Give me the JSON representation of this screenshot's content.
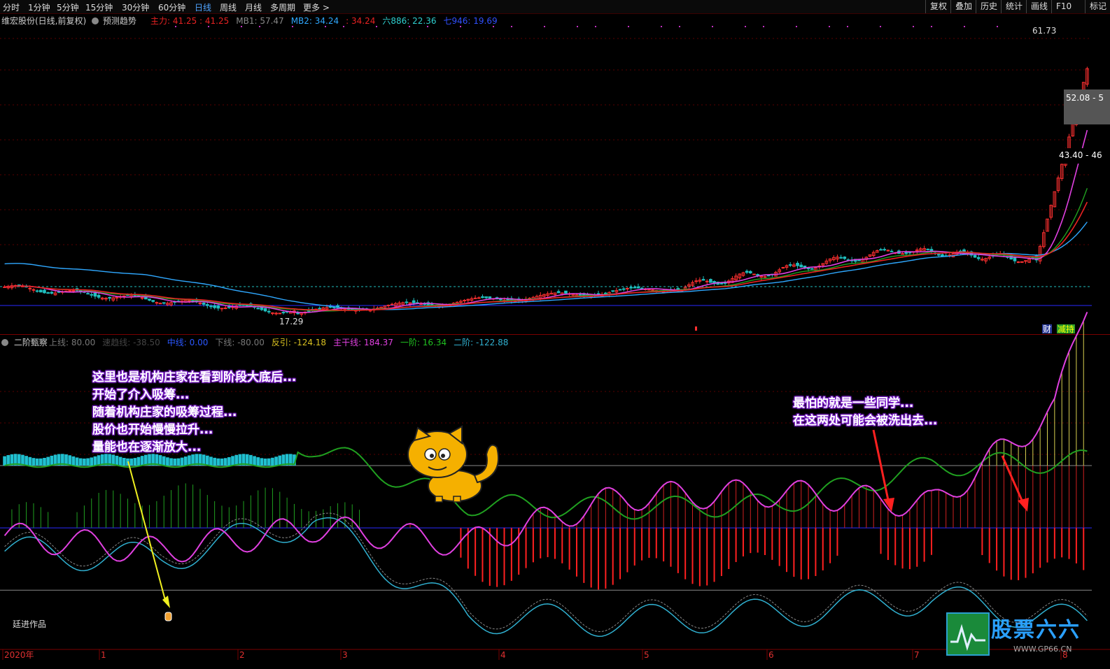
{
  "toolbar": {
    "tabs": [
      "分时",
      "1分钟",
      "5分钟",
      "15分钟",
      "30分钟",
      "60分钟",
      "日线",
      "周线",
      "月线",
      "多周期",
      "更多 >"
    ],
    "active_tab": "日线",
    "right_buttons": [
      "复权",
      "叠加",
      "历史",
      "统计",
      "画线",
      "F10",
      "标记"
    ]
  },
  "main_panel": {
    "stock_title": "维宏股份(日线,前复权)",
    "predict_label": "预测趋势",
    "indicators": [
      {
        "label": "主力: 41.25 : 41.25",
        "color": "#e82222"
      },
      {
        "label": "MB1: 57.47",
        "color": "#888888"
      },
      {
        "label": "MB2: 34.24",
        "color": "#2fa8ff"
      },
      {
        "label": ": 34.24",
        "color": "#e82222"
      },
      {
        "label": "六886: 22.36",
        "color": "#2fd0d0"
      },
      {
        "label": "七946: 19.69",
        "color": "#3050ff"
      }
    ],
    "price_labels": {
      "high": "61.73",
      "low": "17.29",
      "box1": "52.08 - 5",
      "box2": "43.40 - 46"
    },
    "badges": {
      "cai": "财",
      "jian": "减持"
    }
  },
  "sub_panel": {
    "title": "二阶甄察",
    "indicators": [
      {
        "label": "上线: 80.00",
        "color": "#777777"
      },
      {
        "label": "速趋线: -38.50",
        "color": "#444444"
      },
      {
        "label": "中线: 0.00",
        "color": "#2a57ff"
      },
      {
        "label": "下线: -80.00",
        "color": "#777777"
      },
      {
        "label": "反引: -124.18",
        "color": "#d8c020"
      },
      {
        "label": "主干线: 184.37",
        "color": "#e040e0"
      },
      {
        "label": "一阶: 16.34",
        "color": "#20c020"
      },
      {
        "label": "二阶: -122.88",
        "color": "#30b0d0"
      }
    ],
    "author_label": "廷进作品"
  },
  "annotations": {
    "left": [
      "这里也是机构庄家在看到阶段大底后...",
      "开始了介入吸筹...",
      "随着机构庄家的吸筹过程...",
      "股价也开始慢慢拉升...",
      "量能也在逐渐放大..."
    ],
    "right": [
      "最怕的就是一些同学...",
      "在这两处可能会被洗出去..."
    ]
  },
  "xaxis": {
    "labels": [
      "2020年",
      "1",
      "2",
      "3",
      "4",
      "5",
      "6",
      "7",
      "8"
    ]
  },
  "watermark": {
    "brand": "股票六六",
    "url": "WWW.GP66.CN"
  },
  "colors": {
    "up": "#ff3030",
    "down": "#20c0c0",
    "ma_short": "#e82222",
    "ma_mid": "#e040e0",
    "ma_long": "#2fa8ff",
    "ma_green": "#20a020"
  },
  "chart_data": [
    {
      "type": "candlestick",
      "title": "维宏股份(日线,前复权)",
      "x": [
        "2020-01",
        "2020-02",
        "2020-03",
        "2020-04",
        "2020-05",
        "2020-06",
        "2020-07",
        "2020-08"
      ],
      "approx_close": [
        21.5,
        18.5,
        18.0,
        18.8,
        20.5,
        22.8,
        26.5,
        46.0
      ],
      "marked_high": 61.73,
      "marked_low": 17.29,
      "ylim": [
        15,
        63
      ],
      "series_lines": [
        "主力",
        "MB1",
        "MB2",
        "六886",
        "七946"
      ]
    },
    {
      "type": "line",
      "title": "二阶甄察",
      "x": [
        "2020-01",
        "2020-02",
        "2020-03",
        "2020-04",
        "2020-05",
        "2020-06",
        "2020-07",
        "2020-08"
      ],
      "series": [
        {
          "name": "主干线",
          "values": [
            -10,
            -30,
            0,
            -20,
            40,
            45,
            30,
            184
          ]
        },
        {
          "name": "一阶",
          "values": [
            15,
            45,
            35,
            -40,
            -45,
            -40,
            10,
            16
          ]
        },
        {
          "name": "二阶",
          "values": [
            -30,
            -40,
            10,
            -115,
            -120,
            -110,
            -90,
            -123
          ]
        }
      ],
      "reference_lines": {
        "上线": 80,
        "中线": 0,
        "下线": -80
      },
      "ylim": [
        -130,
        220
      ]
    }
  ]
}
